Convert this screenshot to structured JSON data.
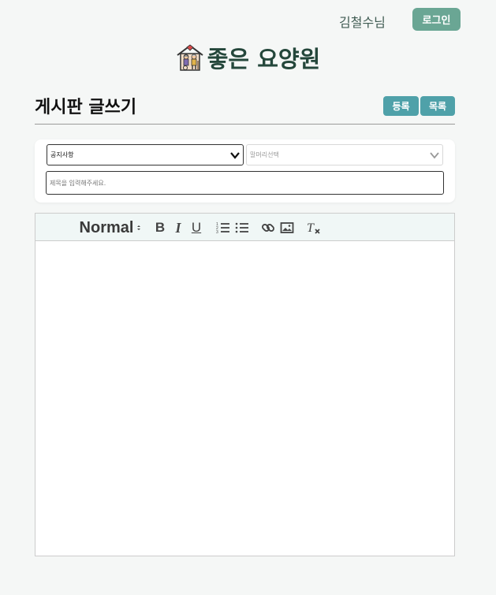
{
  "header": {
    "username": "김철수님",
    "login_label": "로그인"
  },
  "brand": {
    "name": "좋은 요양원",
    "icon": "nursing-home-icon"
  },
  "board": {
    "title": "게시판 글쓰기",
    "register_label": "등록",
    "list_label": "목록"
  },
  "form": {
    "category_selected": "공지사항",
    "header_placeholder": "말머리선택",
    "title_placeholder": "제목을 입력해주세요."
  },
  "editor": {
    "format_label": "Normal",
    "tools": [
      "bold-icon",
      "italic-icon",
      "underline-icon",
      "ordered-list-icon",
      "bullet-list-icon",
      "link-icon",
      "image-icon",
      "clear-format-icon"
    ],
    "content": ""
  },
  "colors": {
    "background": "#f5f7f6",
    "brand_text": "#24473b",
    "login_button": "#6aa694",
    "action_button": "#4fa1a9",
    "toolbar_bg": "#f0f7f6"
  }
}
